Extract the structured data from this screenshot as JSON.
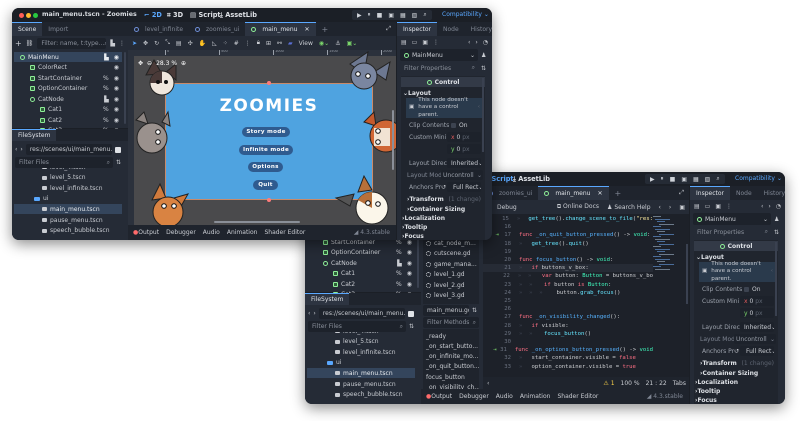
{
  "editor": {
    "title": "main_menu.tscn - Zoomies",
    "workspaces": [
      "2D",
      "3D",
      "Script",
      "AssetLib"
    ],
    "renderer": "Compatibility",
    "run_icons": [
      "play-icon",
      "pause-icon",
      "stop-icon",
      "remote-debug-icon",
      "movie-icon",
      "run-current-icon",
      "search-icon"
    ],
    "colors": {
      "accent": "#5aa8ff",
      "panel": "#252b36",
      "background": "#1b1f26",
      "game_bg": "#4fa3e0",
      "menu_button": "#2f5b8f"
    }
  },
  "scene_dock": {
    "tabs": [
      "Scene",
      "Import"
    ],
    "filter_placeholder": "Filter: name, t:type...",
    "tree": [
      {
        "label": "MainMenu",
        "icon": "node",
        "selected": true
      },
      {
        "label": "ColorRect",
        "icon": "ctrl"
      },
      {
        "label": "StartContainer",
        "icon": "ctrl",
        "badge": "%"
      },
      {
        "label": "OptionContainer",
        "icon": "ctrl",
        "badge": "%"
      },
      {
        "label": "CatNode",
        "icon": "node"
      },
      {
        "label": "Cat1",
        "icon": "ctrl",
        "badge": "%"
      },
      {
        "label": "Cat2",
        "icon": "ctrl",
        "badge": "%"
      },
      {
        "label": "Cat3",
        "icon": "ctrl",
        "badge": "%"
      }
    ]
  },
  "filesystem": {
    "title": "FileSystem",
    "path": "res://scenes/ui/main_menu.tscn",
    "filter_placeholder": "Filter Files",
    "items": [
      {
        "label": "level_4.tscn",
        "type": "file"
      },
      {
        "label": "level_5.tscn",
        "type": "file"
      },
      {
        "label": "level_infinite.tscn",
        "type": "file"
      },
      {
        "label": "ui",
        "type": "folder"
      },
      {
        "label": "main_menu.tscn",
        "type": "file",
        "selected": true
      },
      {
        "label": "pause_menu.tscn",
        "type": "file"
      },
      {
        "label": "speech_bubble.tscn",
        "type": "file"
      }
    ]
  },
  "scene_tabs": [
    "level_infinite",
    "zoomies_ui",
    "main_menu"
  ],
  "canvas": {
    "toolbar_view": "View",
    "zoom": "28.3 %",
    "ruler_ticks": [
      "0",
      "500",
      "1000",
      "1500",
      "2000"
    ],
    "game_title": "ZOOMIES",
    "menu_buttons": [
      "Story mode",
      "Infinite mode",
      "Options",
      "Quit"
    ]
  },
  "bottom_panel": {
    "tabs": [
      "Output",
      "Debugger",
      "Audio",
      "Animation",
      "Shader Editor"
    ],
    "version": "4.3.stable"
  },
  "inspector": {
    "tabs": [
      "Inspector",
      "Node",
      "History"
    ],
    "node": "MainMenu",
    "filter_placeholder": "Filter Properties",
    "class": "Control",
    "section": "Layout",
    "warning": "This node doesn't have a control parent.",
    "clip_contents": {
      "label": "Clip Contents",
      "value": "On",
      "checked": false
    },
    "custom_min": {
      "label": "Custom Mini",
      "x": "0",
      "y": "0",
      "unit": "px"
    },
    "layout_direction": {
      "label": "Layout Directi",
      "value": "Inherited"
    },
    "layout_mode": {
      "label": "Layout Mode",
      "value": "Uncontroll"
    },
    "anchors": {
      "label": "Anchors Pr",
      "value": "Full Rect"
    },
    "subsections": [
      {
        "label": "Transform",
        "note": "(1 change)"
      },
      {
        "label": "Container Sizing",
        "note": ""
      }
    ],
    "groups": [
      "Localization",
      "Tooltip",
      "Focus"
    ]
  },
  "script_editor": {
    "menu": [
      "Debug"
    ],
    "help": [
      "Online Docs",
      "Search Help"
    ],
    "scripts": [
      "cat_node_m...",
      "cutscene.gd",
      "game_mana...",
      "level_1.gd",
      "level_2.gd",
      "level_3.gd"
    ],
    "current_script": "main_menu.gd",
    "methods_filter_placeholder": "Filter Methods",
    "methods": [
      "_ready",
      "_on_start_butto...",
      "_on_infinite_mo...",
      "_on_quit_button...",
      "focus_button",
      "_on_visibility_ch..."
    ],
    "current_line": 21,
    "lines": [
      {
        "n": 15,
        "indent": 1,
        "text": "get_tree().change_scene_to_file(\"res:"
      },
      {
        "n": 16,
        "indent": 0,
        "text": ""
      },
      {
        "n": 17,
        "indent": 0,
        "text": "func _on_quit_button_pressed() -> void:",
        "signal": true
      },
      {
        "n": 18,
        "indent": 1,
        "text": "get_tree().quit()"
      },
      {
        "n": 19,
        "indent": 0,
        "text": ""
      },
      {
        "n": 20,
        "indent": 0,
        "text": "func focus_button() -> void:"
      },
      {
        "n": 21,
        "indent": 1,
        "text": "if buttons_v_box:"
      },
      {
        "n": 22,
        "indent": 2,
        "text": "var button: Button = buttons_v_bo"
      },
      {
        "n": 23,
        "indent": 2,
        "text": "if button is Button:"
      },
      {
        "n": 24,
        "indent": 3,
        "text": "button.grab_focus()"
      },
      {
        "n": 25,
        "indent": 0,
        "text": ""
      },
      {
        "n": 26,
        "indent": 0,
        "text": ""
      },
      {
        "n": 27,
        "indent": 0,
        "text": "func _on_visibility_changed():"
      },
      {
        "n": 28,
        "indent": 1,
        "text": "if visible:"
      },
      {
        "n": 29,
        "indent": 2,
        "text": "focus_button()"
      },
      {
        "n": 30,
        "indent": 0,
        "text": ""
      },
      {
        "n": 31,
        "indent": 0,
        "text": "func _on_options_button_pressed() -> void",
        "signal": true
      },
      {
        "n": 32,
        "indent": 1,
        "text": "start_container.visible = false"
      },
      {
        "n": 33,
        "indent": 1,
        "text": "option_container.visible = true"
      }
    ],
    "status": {
      "warnings": "1",
      "zoom": "100 %",
      "line": "21",
      "col": "22",
      "indent_mode": "Tabs"
    }
  }
}
